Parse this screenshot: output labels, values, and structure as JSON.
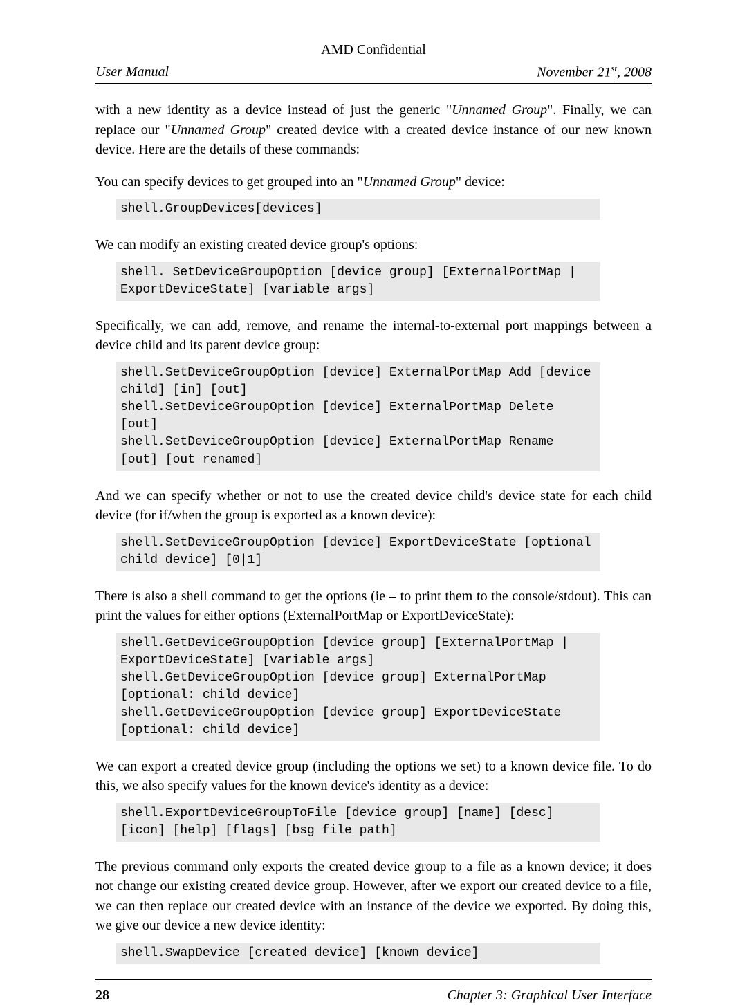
{
  "header": {
    "classification": "AMD Confidential",
    "left": "User Manual",
    "date_prefix": "November 21",
    "date_super": "st",
    "date_suffix": ", 2008"
  },
  "paragraphs": {
    "p1_a": "with a new identity as a device instead of just the generic \"",
    "p1_i1": "Unnamed Group",
    "p1_b": "\". Finally, we can replace our \"",
    "p1_i2": "Unnamed Group",
    "p1_c": "\" created device with a created device instance of our new known device. Here are the details of these commands:",
    "p2_a": "You can specify devices to get grouped into an \"",
    "p2_i1": "Unnamed Group",
    "p2_b": "\" device:",
    "p3": "We can modify an existing created device group's options:",
    "p4": "Specifically, we can add, remove, and rename the internal-to-external port mappings between a device child and its parent device group:",
    "p5": "And we can specify whether or not to use the created device child's device state for each child device (for if/when the group is exported as a known device):",
    "p6": "There is also a shell command to get the options (ie – to print them to the console/stdout). This can print the values for either options (ExternalPortMap or ExportDeviceState):",
    "p7": "We can export a created device group (including the options we set) to a known device file. To do this, we also specify values for the known device's identity as a device:",
    "p8": "The previous command only exports the created device group to a file as a known device; it does not change our existing created device group. However, after we export our created device to a file, we can then replace our created device with an instance of the device we exported. By doing this, we give our device a new device identity:"
  },
  "code": {
    "c1": "shell.GroupDevices[devices]",
    "c2": "shell. SetDeviceGroupOption [device group] [ExternalPortMap | ExportDeviceState] [variable args]",
    "c3": "shell.SetDeviceGroupOption [device] ExternalPortMap Add [device child] [in] [out]\nshell.SetDeviceGroupOption [device] ExternalPortMap Delete [out]\nshell.SetDeviceGroupOption [device] ExternalPortMap Rename [out] [out renamed]",
    "c4": "shell.SetDeviceGroupOption [device] ExportDeviceState [optional child device] [0|1]",
    "c5": "shell.GetDeviceGroupOption [device group] [ExternalPortMap | ExportDeviceState] [variable args]\nshell.GetDeviceGroupOption [device group] ExternalPortMap [optional: child device]\nshell.GetDeviceGroupOption [device group] ExportDeviceState [optional: child device]",
    "c6": "shell.ExportDeviceGroupToFile [device group] [name] [desc] [icon] [help] [flags] [bsg file path]",
    "c7": "shell.SwapDevice [created device] [known device]"
  },
  "footer": {
    "page": "28",
    "chapter": "Chapter 3: Graphical User Interface"
  }
}
